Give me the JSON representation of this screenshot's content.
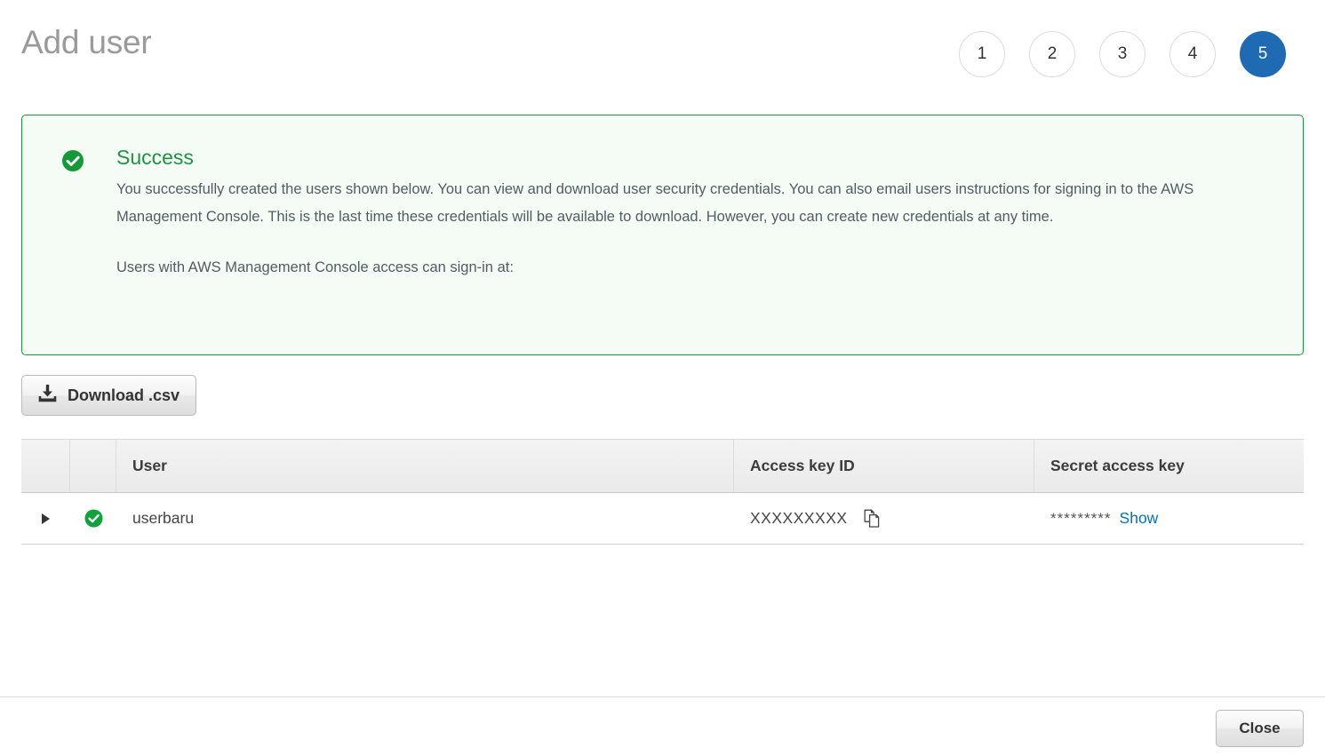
{
  "header": {
    "title": "Add user",
    "steps": [
      {
        "label": "1",
        "active": false
      },
      {
        "label": "2",
        "active": false
      },
      {
        "label": "3",
        "active": false
      },
      {
        "label": "4",
        "active": false
      },
      {
        "label": "5",
        "active": true
      }
    ]
  },
  "alert": {
    "icon": "check-circle-icon",
    "title": "Success",
    "paragraph1": "You successfully created the users shown below. You can view and download user security credentials. You can also email users instructions for signing in to the AWS Management Console. This is the last time these credentials will be available to download. However, you can create new credentials at any time.",
    "paragraph2": "Users with AWS Management Console access can sign-in at:"
  },
  "toolbar": {
    "download_label": "Download .csv",
    "download_icon": "download-icon"
  },
  "table": {
    "columns": {
      "expand": "",
      "status": "",
      "user": "User",
      "access_key_id": "Access key ID",
      "secret_access_key": "Secret access key"
    },
    "rows": [
      {
        "expand_icon": "triangle-right-icon",
        "status_icon": "check-circle-icon",
        "user": "userbaru",
        "access_key_id": "XXXXXXXXX",
        "copy_icon": "copy-icon",
        "secret_mask": "*********",
        "show_label": "Show"
      }
    ]
  },
  "footer": {
    "close_label": "Close"
  },
  "colors": {
    "accent_blue": "#1f6bb3",
    "link_blue": "#0073bb",
    "success_green": "#1d9440",
    "alert_bg": "#f4fcf5",
    "title_gray": "#9a9a9a"
  }
}
